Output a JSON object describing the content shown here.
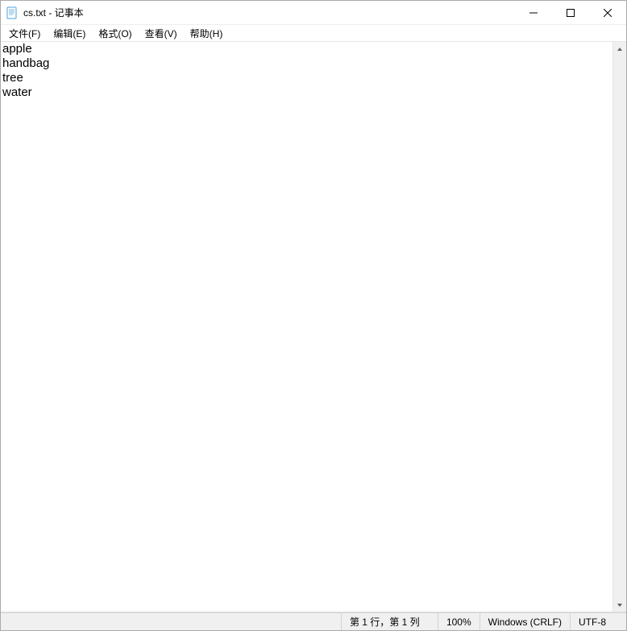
{
  "window": {
    "title": "cs.txt - 记事本"
  },
  "menu": {
    "file": "文件(F)",
    "edit": "编辑(E)",
    "format": "格式(O)",
    "view": "查看(V)",
    "help": "帮助(H)"
  },
  "editor": {
    "content": "apple\nhandbag\ntree\nwater"
  },
  "status": {
    "position": "第 1 行，第 1 列",
    "zoom": "100%",
    "line_ending": "Windows (CRLF)",
    "encoding": "UTF-8"
  }
}
